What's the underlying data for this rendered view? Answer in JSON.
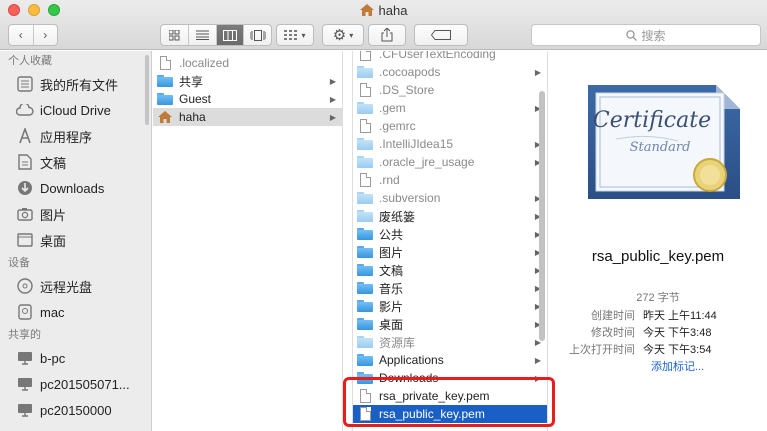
{
  "window": {
    "title": "haha"
  },
  "toolbar": {
    "search_placeholder": "搜索"
  },
  "sidebar": {
    "sections": [
      {
        "header": "个人收藏",
        "items": [
          {
            "label": "我的所有文件",
            "icon": "all-files-icon"
          },
          {
            "label": "iCloud Drive",
            "icon": "cloud-icon"
          },
          {
            "label": "应用程序",
            "icon": "applications-icon"
          },
          {
            "label": "文稿",
            "icon": "documents-icon"
          },
          {
            "label": "Downloads",
            "icon": "downloads-icon"
          },
          {
            "label": "图片",
            "icon": "pictures-icon"
          },
          {
            "label": "桌面",
            "icon": "desktop-icon"
          }
        ]
      },
      {
        "header": "设备",
        "items": [
          {
            "label": "远程光盘",
            "icon": "disc-icon"
          },
          {
            "label": "mac",
            "icon": "hard-drive-icon"
          }
        ]
      },
      {
        "header": "共享的",
        "items": [
          {
            "label": "b-pc",
            "icon": "computer-icon"
          },
          {
            "label": "pc201505071...",
            "icon": "computer-icon"
          },
          {
            "label": "pc20150000",
            "icon": "computer-icon"
          }
        ]
      }
    ]
  },
  "column1": {
    "items": [
      {
        "name": ".localized",
        "kind": "doc",
        "dim": true,
        "arrow": false
      },
      {
        "name": "共享",
        "kind": "folder",
        "dim": false,
        "arrow": true
      },
      {
        "name": "Guest",
        "kind": "folder",
        "dim": false,
        "arrow": true
      },
      {
        "name": "haha",
        "kind": "home",
        "dim": false,
        "arrow": true,
        "selected": true
      }
    ]
  },
  "column2": {
    "items": [
      {
        "name": ".CFUserTextEncoding",
        "kind": "doc",
        "dim": true,
        "arrow": false
      },
      {
        "name": ".cocoapods",
        "kind": "folder-pale",
        "dim": true,
        "arrow": true
      },
      {
        "name": ".DS_Store",
        "kind": "doc",
        "dim": true,
        "arrow": false
      },
      {
        "name": ".gem",
        "kind": "folder-pale",
        "dim": true,
        "arrow": true
      },
      {
        "name": ".gemrc",
        "kind": "doc",
        "dim": true,
        "arrow": false
      },
      {
        "name": ".IntelliJIdea15",
        "kind": "folder-pale",
        "dim": true,
        "arrow": true
      },
      {
        "name": ".oracle_jre_usage",
        "kind": "folder-pale",
        "dim": true,
        "arrow": true
      },
      {
        "name": ".rnd",
        "kind": "doc",
        "dim": true,
        "arrow": false
      },
      {
        "name": ".subversion",
        "kind": "folder-pale",
        "dim": true,
        "arrow": true
      },
      {
        "name": "废纸篓",
        "kind": "folder-pale",
        "dim": false,
        "arrow": true
      },
      {
        "name": "公共",
        "kind": "folder",
        "dim": false,
        "arrow": true
      },
      {
        "name": "图片",
        "kind": "folder",
        "dim": false,
        "arrow": true
      },
      {
        "name": "文稿",
        "kind": "folder",
        "dim": false,
        "arrow": true
      },
      {
        "name": "音乐",
        "kind": "folder",
        "dim": false,
        "arrow": true
      },
      {
        "name": "影片",
        "kind": "folder",
        "dim": false,
        "arrow": true
      },
      {
        "name": "桌面",
        "kind": "folder",
        "dim": false,
        "arrow": true
      },
      {
        "name": "资源库",
        "kind": "folder-pale",
        "dim": true,
        "arrow": true
      },
      {
        "name": "Applications",
        "kind": "folder",
        "dim": false,
        "arrow": true
      },
      {
        "name": "Downloads",
        "kind": "folder",
        "dim": false,
        "arrow": true
      },
      {
        "name": "rsa_private_key.pem",
        "kind": "doc",
        "dim": false,
        "arrow": false
      },
      {
        "name": "rsa_public_key.pem",
        "kind": "doc",
        "dim": false,
        "arrow": false,
        "selected": true
      }
    ]
  },
  "preview": {
    "file_name": "rsa_public_key.pem",
    "file_size": "272 字节",
    "cert_title": "Certificate",
    "cert_subtitle": "Standard",
    "meta": [
      {
        "key": "创建时间",
        "value": "昨天 上午11:44"
      },
      {
        "key": "修改时间",
        "value": "今天 下午3:48"
      },
      {
        "key": "上次打开时间",
        "value": "今天 下午3:54"
      }
    ],
    "add_tags": "添加标记..."
  },
  "colors": {
    "selection": "#1a5fc6",
    "highlight_box": "#e81d1d"
  }
}
